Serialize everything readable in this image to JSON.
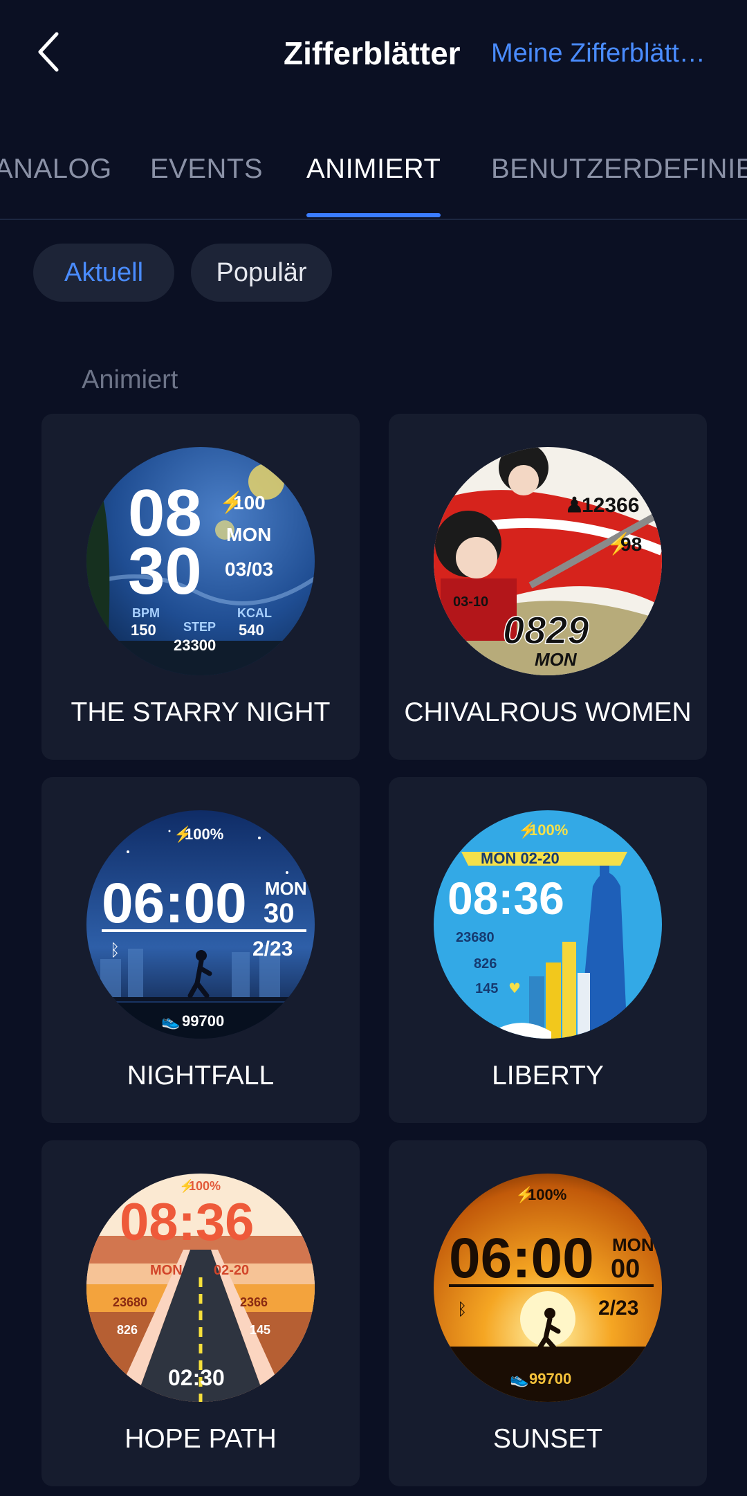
{
  "header": {
    "title": "Zifferblätter",
    "my_faces_link": "Meine Zifferblätt…"
  },
  "tabs": [
    {
      "label": "ANALOG"
    },
    {
      "label": "EVENTS"
    },
    {
      "label": "ANIMIERT",
      "active": true
    },
    {
      "label": "BENUTZERDEFINIERT"
    }
  ],
  "filters": {
    "current": "Aktuell",
    "popular": "Populär"
  },
  "section_title": "Animiert",
  "accent_color": "#3b7dff",
  "faces": [
    {
      "name": "THE STARRY NIGHT",
      "hour": "08",
      "minute": "30",
      "battery": "100",
      "weekday": "MON",
      "date": "03/03",
      "bpm_label": "BPM",
      "bpm": "150",
      "step_label": "STEP",
      "steps": "23300",
      "kcal_label": "KCAL",
      "kcal": "540"
    },
    {
      "name": "CHIVALROUS WOMEN",
      "steps": "12366",
      "battery": "98",
      "date": "03-10",
      "time": "0829",
      "weekday": "MON"
    },
    {
      "name": "NIGHTFALL",
      "battery": "100%",
      "time": "06:00",
      "weekday": "MON",
      "day": "30",
      "date": "2/23",
      "steps": "99700"
    },
    {
      "name": "LIBERTY",
      "battery": "100%",
      "date": "MON 02-20",
      "time": "08:36",
      "steps": "23680",
      "kcal": "826",
      "bpm": "145"
    },
    {
      "name": "HOPE PATH",
      "battery": "100%",
      "time": "08:36",
      "weekday": "MON",
      "date": "02-20",
      "steps": "23680",
      "kcal": "2366",
      "distance": "826",
      "bpm": "145",
      "seconds": "02:30"
    },
    {
      "name": "SUNSET",
      "battery": "100%",
      "time": "06:00",
      "weekday": "MON",
      "day": "00",
      "date": "2/23",
      "steps": "99700"
    }
  ]
}
